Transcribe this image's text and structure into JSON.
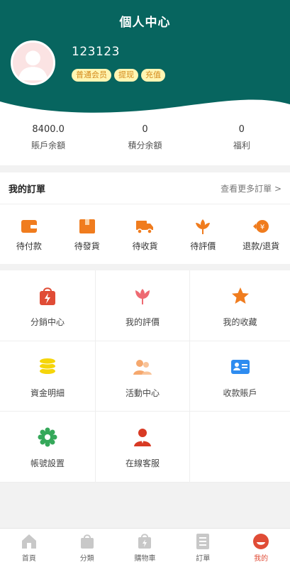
{
  "header": {
    "title": "個人中心",
    "username": "123123"
  },
  "badges": [
    "普通会员",
    "提现",
    "充值"
  ],
  "stats": [
    {
      "value": "8400.0",
      "label": "賬戶余額"
    },
    {
      "value": "0",
      "label": "積分余額"
    },
    {
      "value": "0",
      "label": "福利"
    }
  ],
  "orders": {
    "title": "我的訂單",
    "more": "查看更多訂單 >",
    "items": [
      {
        "label": "待付款",
        "icon": "wallet-icon"
      },
      {
        "label": "待發貨",
        "icon": "box-icon"
      },
      {
        "label": "待收貨",
        "icon": "truck-icon"
      },
      {
        "label": "待評價",
        "icon": "flower-icon"
      },
      {
        "label": "退款/退貨",
        "icon": "refund-icon"
      }
    ]
  },
  "menu": [
    {
      "label": "分銷中心",
      "icon": "bag-bolt-icon"
    },
    {
      "label": "我的評價",
      "icon": "tulip-icon"
    },
    {
      "label": "我的收藏",
      "icon": "star-icon"
    },
    {
      "label": "資金明細",
      "icon": "coin-stack-icon"
    },
    {
      "label": "活動中心",
      "icon": "people-icon"
    },
    {
      "label": "收款賬戶",
      "icon": "id-card-icon"
    },
    {
      "label": "帳號設置",
      "icon": "gear-icon"
    },
    {
      "label": "在線客服",
      "icon": "agent-icon"
    }
  ],
  "tabbar": [
    {
      "label": "首頁",
      "icon": "home-icon"
    },
    {
      "label": "分類",
      "icon": "category-bag-icon"
    },
    {
      "label": "購物車",
      "icon": "cart-icon"
    },
    {
      "label": "訂單",
      "icon": "order-list-icon"
    },
    {
      "label": "我的",
      "icon": "profile-icon",
      "active": true
    }
  ],
  "colors": {
    "header": "#07655f",
    "badge_bg": "#fff5b3",
    "badge_text": "#d48a1b",
    "accent": "#e04c36",
    "orange": "#f07c1e"
  }
}
